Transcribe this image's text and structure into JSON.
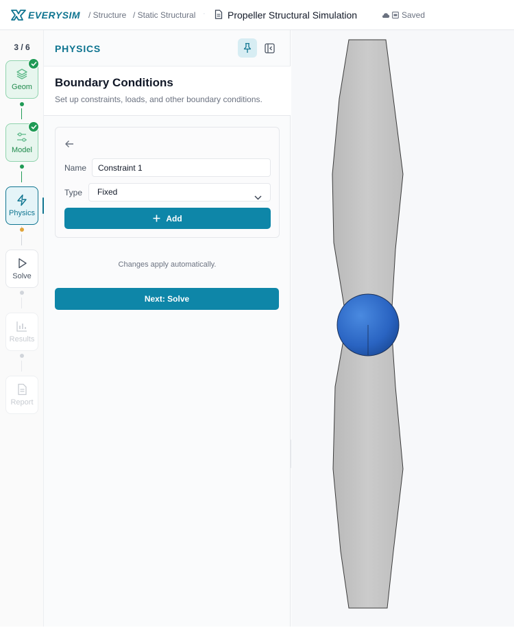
{
  "header": {
    "logo_text": "EVERYSIM",
    "breadcrumb": [
      "/ Structure",
      "/ Static Structural"
    ],
    "separator": "·",
    "project_title": "Propeller Structural Simulation",
    "save_status": "Saved"
  },
  "rail": {
    "step_count": "3 / 6",
    "steps": [
      {
        "label": "Geom",
        "state": "done",
        "icon": "layers-icon"
      },
      {
        "label": "Model",
        "state": "done",
        "icon": "sliders-icon"
      },
      {
        "label": "Physics",
        "state": "active",
        "icon": "lightning-icon"
      },
      {
        "label": "Solve",
        "state": "todo",
        "icon": "play-icon"
      },
      {
        "label": "Results",
        "state": "disabled",
        "icon": "bar-chart-icon"
      },
      {
        "label": "Report",
        "state": "disabled",
        "icon": "document-icon"
      }
    ]
  },
  "panel": {
    "title": "PHYSICS",
    "section_title": "Boundary Conditions",
    "section_subtitle": "Set up constraints, loads, and other boundary conditions.",
    "form": {
      "name_label": "Name",
      "name_value": "Constraint 1",
      "type_label": "Type",
      "type_value": "Fixed",
      "add_label": "Add"
    },
    "auto_note": "Changes apply automatically.",
    "next_label": "Next: Solve"
  },
  "colors": {
    "accent": "#0e86a8",
    "done": "#1f9a55",
    "pending_dot": "#e0a43a",
    "hub": "#2f6fce",
    "blade": "#c8c8c8"
  }
}
